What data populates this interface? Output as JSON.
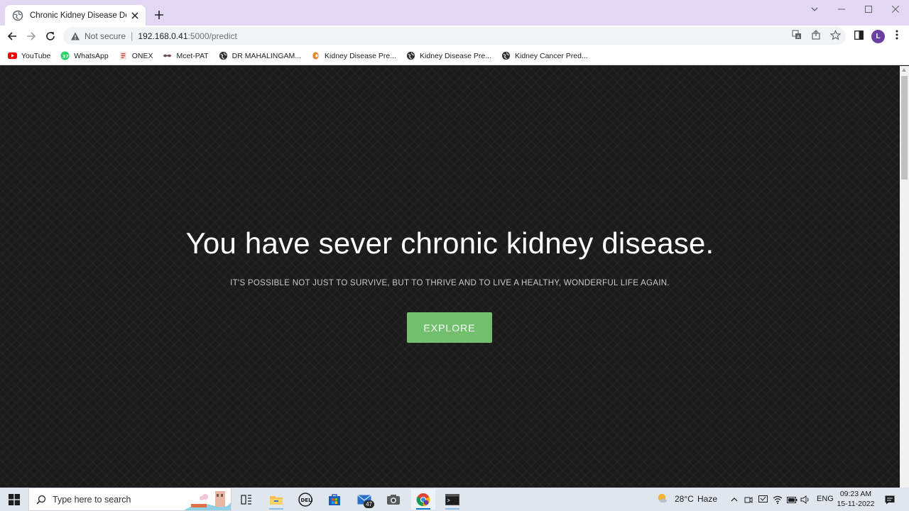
{
  "browser": {
    "tab": {
      "title": "Chronic Kidney Disease Detection",
      "close_icon": "close-icon"
    },
    "new_tab_icon": "plus-icon",
    "window_controls": [
      "chevron-down-icon",
      "minimize-icon",
      "maximize-icon",
      "close-icon"
    ],
    "address": {
      "security_label": "Not secure",
      "separator": "|",
      "host": "192.168.0.41",
      "path": ":5000/predict"
    },
    "profile_initial": "L",
    "bookmarks": [
      {
        "label": "YouTube",
        "icon": "youtube-icon",
        "color": "#ff0000"
      },
      {
        "label": "WhatsApp",
        "icon": "whatsapp-icon",
        "color": "#25d366"
      },
      {
        "label": "ONEX",
        "icon": "onex-icon",
        "color": "#c0392b"
      },
      {
        "label": "Mcet-PAT",
        "icon": "mcet-icon",
        "color": "#b03030"
      },
      {
        "label": "DR MAHALINGAM...",
        "icon": "globe-icon",
        "color": "#333333"
      },
      {
        "label": "Kidney Disease Pre...",
        "icon": "kidney-icon",
        "color": "#e8862a"
      },
      {
        "label": "Kidney Disease Pre...",
        "icon": "globe-icon",
        "color": "#333333"
      },
      {
        "label": "Kidney Cancer Pred...",
        "icon": "globe-icon",
        "color": "#333333"
      }
    ]
  },
  "page": {
    "headline": "You have sever chronic kidney disease.",
    "subtitle": "IT'S POSSIBLE NOT JUST TO SURVIVE, BUT TO THRIVE AND TO LIVE A HEALTHY, WONDERFUL LIFE AGAIN.",
    "explore_label": "EXPLORE",
    "accent": "#72c06e"
  },
  "taskbar": {
    "search_placeholder": "Type here to search",
    "mail_badge": "47",
    "weather": {
      "temp": "28°C",
      "condition": "Haze"
    },
    "language": "ENG",
    "time": "09:23 AM",
    "date": "15-11-2022"
  }
}
